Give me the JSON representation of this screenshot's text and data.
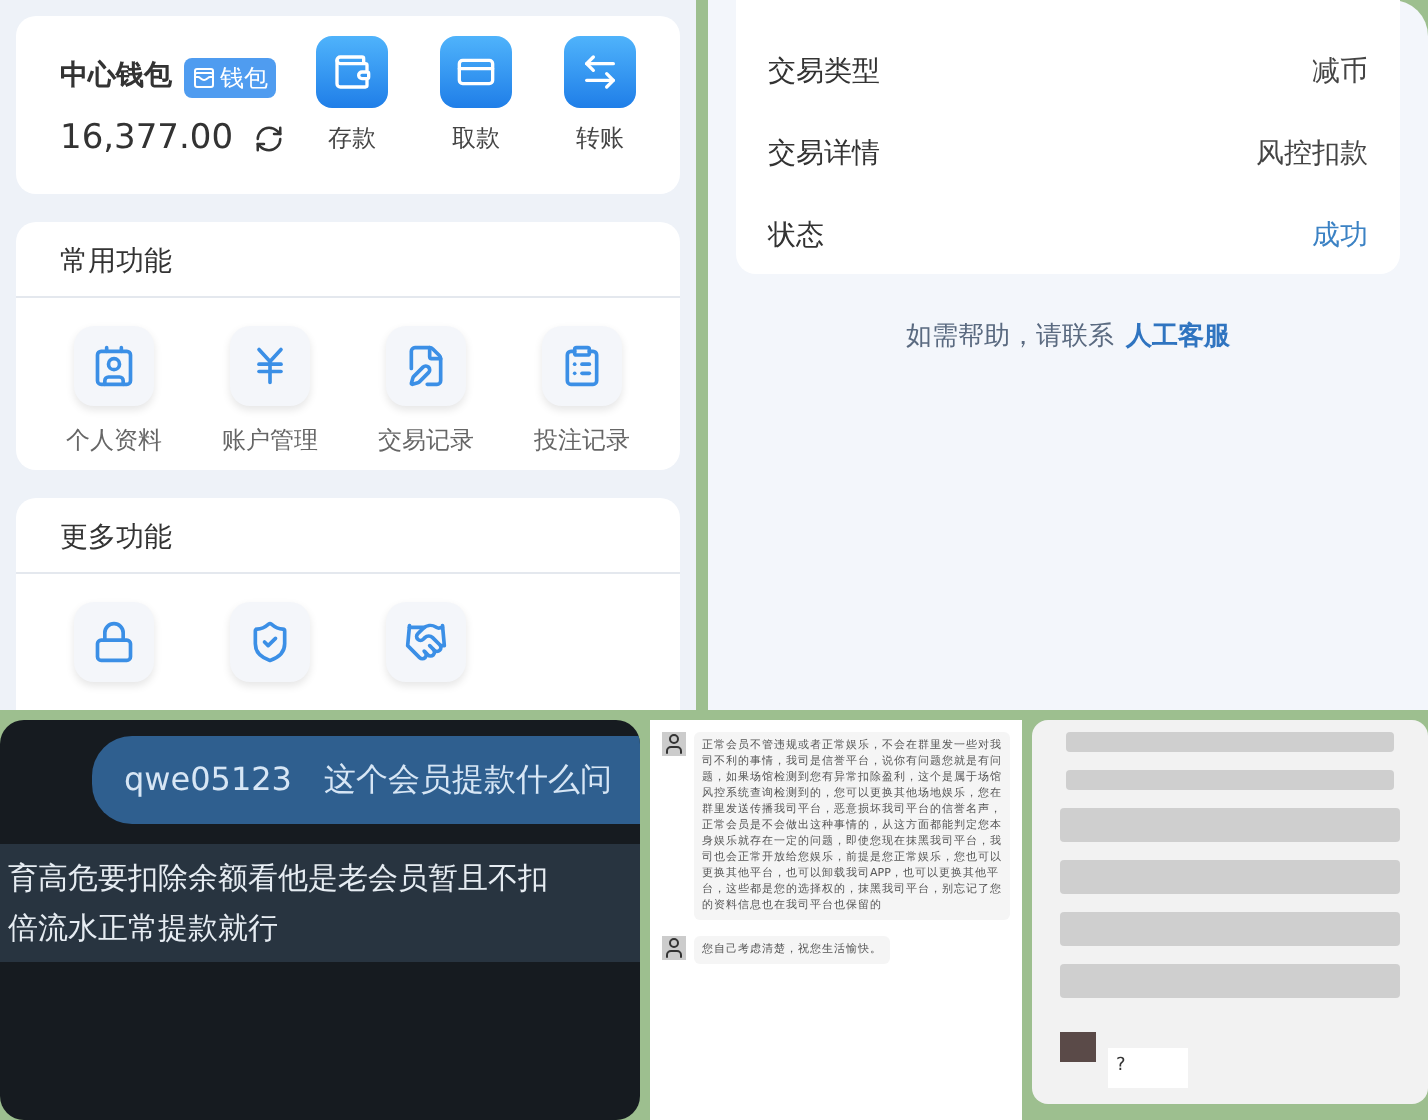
{
  "wallet": {
    "title": "中心钱包",
    "badge": "钱包",
    "balance": "16,377.00",
    "actions": [
      {
        "label": "存款",
        "kind": "wallet"
      },
      {
        "label": "取款",
        "kind": "card"
      },
      {
        "label": "转账",
        "kind": "transfer"
      }
    ]
  },
  "common_functions": {
    "title": "常用功能",
    "items": [
      {
        "label": "个人资料",
        "kind": "profile"
      },
      {
        "label": "账户管理",
        "kind": "moneybag"
      },
      {
        "label": "交易记录",
        "kind": "edit"
      },
      {
        "label": "投注记录",
        "kind": "clipboard"
      }
    ]
  },
  "more_functions": {
    "title": "更多功能",
    "items": [
      {
        "kind": "lock"
      },
      {
        "kind": "shield"
      },
      {
        "kind": "handshake"
      }
    ]
  },
  "transaction": {
    "rows": [
      {
        "label": "交易类型",
        "value": "减币",
        "kind": "plain"
      },
      {
        "label": "交易详情",
        "value": "风控扣款",
        "kind": "plain"
      },
      {
        "label": "状态",
        "value": "成功",
        "kind": "status"
      }
    ],
    "help_text": "如需帮助，请联系",
    "help_link": "人工客服"
  },
  "dark_chat": {
    "username": "qwe05123",
    "message": "这个会员提款什么问",
    "reply_lines": [
      "育高危要扣除余额看他是老会员暂且不扣",
      "倍流水正常提款就行"
    ]
  },
  "support_chat": {
    "messages": [
      {
        "text": "正常会员不管违规或者正常娱乐，不会在群里发一些对我司不利的事情，我司是信誉平台，说你有问题您就是有问题，如果场馆检测到您有异常扣除盈利，这个是属于场馆风控系统查询检测到的，您可以更换其他场地娱乐，您在群里发送传播我司平台，恶意损坏我司平台的信誉名声，正常会员是不会做出这种事情的，从这方面都能判定您本身娱乐就存在一定的问题，即使您现在抹黑我司平台，我司也会正常开放给您娱乐，前提是您正常娱乐，您也可以更换其他平台，也可以卸载我司APP，也可以更换其他平台，这些都是您的选择权的，抹黑我司平台，别忘记了您的资料信息也在我司平台也保留的"
      },
      {
        "text": "您自己考虑清楚，祝您生活愉快。"
      }
    ]
  },
  "group_chat": {
    "reply": "?"
  }
}
